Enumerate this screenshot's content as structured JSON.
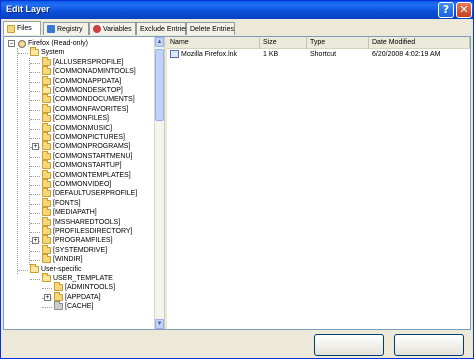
{
  "window": {
    "title": "Edit Layer",
    "help_label": "?",
    "close_label": "✕"
  },
  "tabs": [
    {
      "label": "Files",
      "icon": "files-icon",
      "active": true
    },
    {
      "label": "Registry",
      "icon": "registry-icon",
      "active": false
    },
    {
      "label": "Variables",
      "icon": "variables-icon",
      "active": false
    },
    {
      "label": "Exclude Entries",
      "icon": "",
      "active": false
    },
    {
      "label": "Delete Entries",
      "icon": "",
      "active": false
    }
  ],
  "tree": {
    "root": "Firefox (Read-only)",
    "system": "System",
    "system_children": [
      "[ALLUSERSPROFILE]",
      "[COMMONADMINTOOLS]",
      "[COMMONAPPDATA]",
      "[COMMONDESKTOP]",
      "[COMMONDOCUMENTS]",
      "[COMMONFAVORITES]",
      "[COMMONFILES]",
      "[COMMONMUSIC]",
      "[COMMONPICTURES]",
      "[COMMONPROGRAMS]",
      "[COMMONSTARTMENU]",
      "[COMMONSTARTUP]",
      "[COMMONTEMPLATES]",
      "[COMMONVIDEO]",
      "[DEFAULTUSERPROFILE]",
      "[FONTS]",
      "[MEDIAPATH]",
      "[MSSHAREDTOOLS]",
      "[PROFILESDIRECTORY]",
      "[PROGRAMFILES]",
      "[SYSTEMDRIVE]",
      "[WINDIR]"
    ],
    "user_specific": "User-specific",
    "user_template": "USER_TEMPLATE",
    "user_template_children": [
      "[ADMINTOOLS]",
      "[APPDATA]",
      "[CACHE]"
    ]
  },
  "list": {
    "columns": [
      "Name",
      "Size",
      "Type",
      "Date Modified"
    ],
    "rows": [
      {
        "name": "Mozilla Firefox.lnk",
        "size": "1 KB",
        "type": "Shortcut",
        "date": "6/20/2008 4:02:19 AM"
      }
    ]
  },
  "colors": {
    "titlebar": "#0a5ce8",
    "face": "#ece9d8",
    "folder": "#f5d77a"
  }
}
